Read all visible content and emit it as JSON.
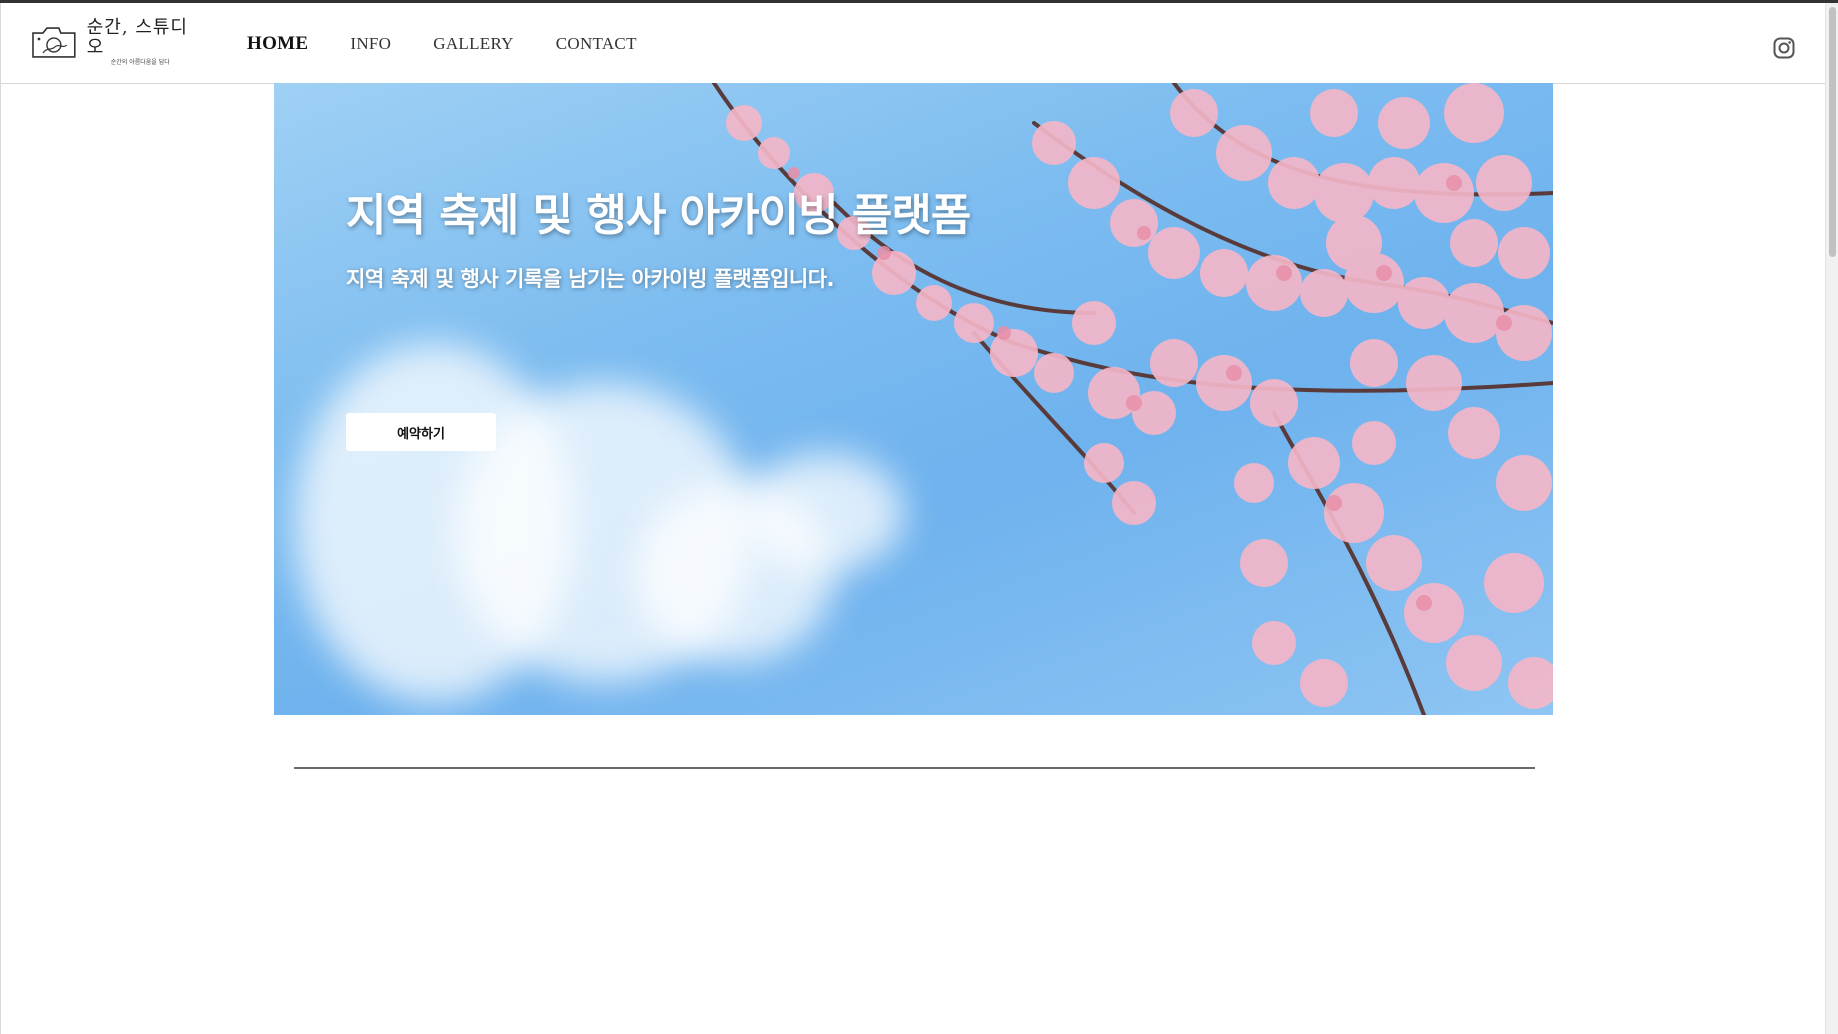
{
  "brand": {
    "name": "순간, 스튜디오",
    "tagline": "순간의 아름다움을 담다"
  },
  "nav": {
    "items": [
      {
        "label": "HOME",
        "active": true
      },
      {
        "label": "INFO",
        "active": false
      },
      {
        "label": "GALLERY",
        "active": false
      },
      {
        "label": "CONTACT",
        "active": false
      }
    ],
    "social_icon": "instagram-icon"
  },
  "hero": {
    "title": "지역 축제 및 행사 아카이빙 플랫폼",
    "subtitle": "지역 축제 및 행사 기록을 남기는 아카이빙 플랫폼입니다.",
    "cta_label": "예약하기"
  },
  "colors": {
    "sky": "#7cbcf0",
    "blossom": "#f4b6c8",
    "branch": "#5a3b3b",
    "divider": "#6a6a6a"
  }
}
